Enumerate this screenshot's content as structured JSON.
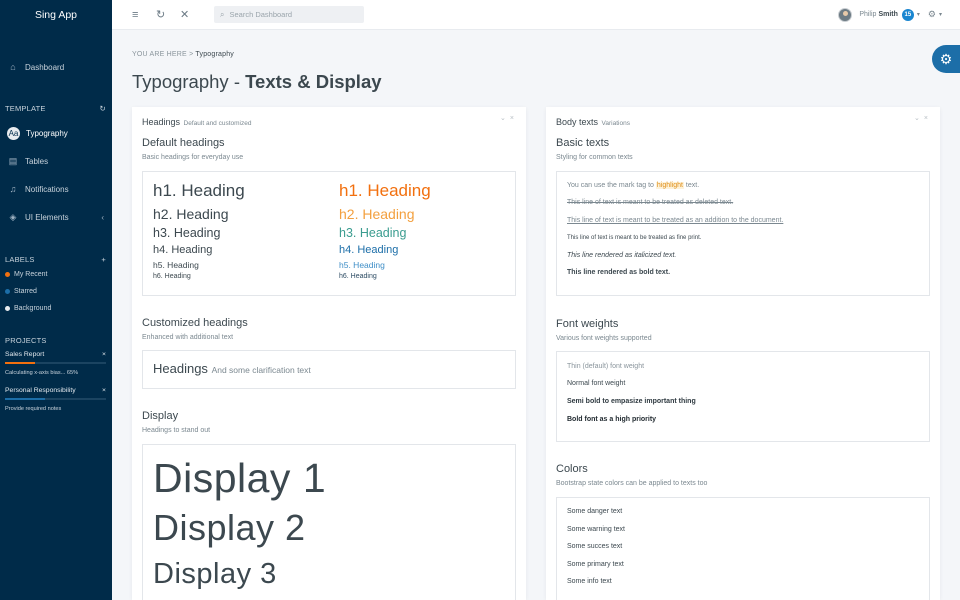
{
  "sidebar": {
    "brand": "Sing App",
    "nav": [
      {
        "label": "Dashboard",
        "icon": "home-icon"
      },
      {
        "label": "Typography",
        "icon": "typography-icon",
        "active": true
      },
      {
        "label": "Tables",
        "icon": "table-icon"
      },
      {
        "label": "Notifications",
        "icon": "bell-icon"
      },
      {
        "label": "UI Elements",
        "icon": "layers-icon"
      }
    ],
    "template_title": "TEMPLATE",
    "labels_title": "LABELS",
    "labels": [
      {
        "label": "My Recent",
        "color": "#f2700f"
      },
      {
        "label": "Starred",
        "color": "#1c6ea8"
      },
      {
        "label": "Background",
        "color": "#e8ecef"
      }
    ],
    "projects_title": "PROJECTS",
    "projects": [
      {
        "name": "Sales Report",
        "sub": "Calculating x-axis bias... 65%",
        "progress": 0.3,
        "color": "#f2700f"
      },
      {
        "name": "Personal Responsibility",
        "sub": "Provide required notes",
        "progress": 0.4,
        "color": "#1c6ea8"
      }
    ]
  },
  "header": {
    "search_placeholder": "Search Dashboard",
    "user_first": "Philip",
    "user_last": "Smith",
    "badge_count": "15"
  },
  "breadcrumb": {
    "prefix": "YOU ARE HERE",
    "separator": ">",
    "current": "Typography"
  },
  "page_title": {
    "light": "Typography - ",
    "bold": "Texts & Display"
  },
  "left_widget": {
    "title": "Headings",
    "title_small": "Default and customized",
    "default_h": "Default headings",
    "default_sub": "Basic headings for everyday use",
    "headings": [
      "h1. Heading",
      "h2. Heading",
      "h3. Heading",
      "h4. Heading",
      "h5. Heading",
      "h6. Heading"
    ],
    "custom_h": "Customized headings",
    "custom_sub": "Enhanced with additional text",
    "custom_main": "Headings",
    "custom_small": "And some clarification text",
    "display_h": "Display",
    "display_sub": "Headings to stand out",
    "displays": [
      "Display 1",
      "Display 2",
      "Display 3"
    ]
  },
  "right_widget": {
    "title": "Body texts",
    "title_small": "Variations",
    "basic_h": "Basic texts",
    "basic_sub": "Styling for common texts",
    "mark_pre": "You can use the mark tag to",
    "mark_word": "highlight",
    "mark_post": "text.",
    "deleted": "This line of text is meant to be treated as deleted text.",
    "inserted": "This line of text is meant to be treated as an addition to the document.",
    "fine": "This line of text is meant to be treated as fine print.",
    "italic": "This line rendered as italicized text.",
    "bold": "This line rendered as bold text.",
    "weights_h": "Font weights",
    "weights_sub": "Various font weights supported",
    "weights": [
      "Thin (default) font weight",
      "Normal font weight",
      "Semi bold to empasize important thing",
      "Bold font as a high priority"
    ],
    "colors_h": "Colors",
    "colors_sub": "Bootstrap state colors can be applied to texts too",
    "colors": [
      "Some danger text",
      "Some warning text",
      "Some succes text",
      "Some primary text",
      "Some info text"
    ]
  }
}
